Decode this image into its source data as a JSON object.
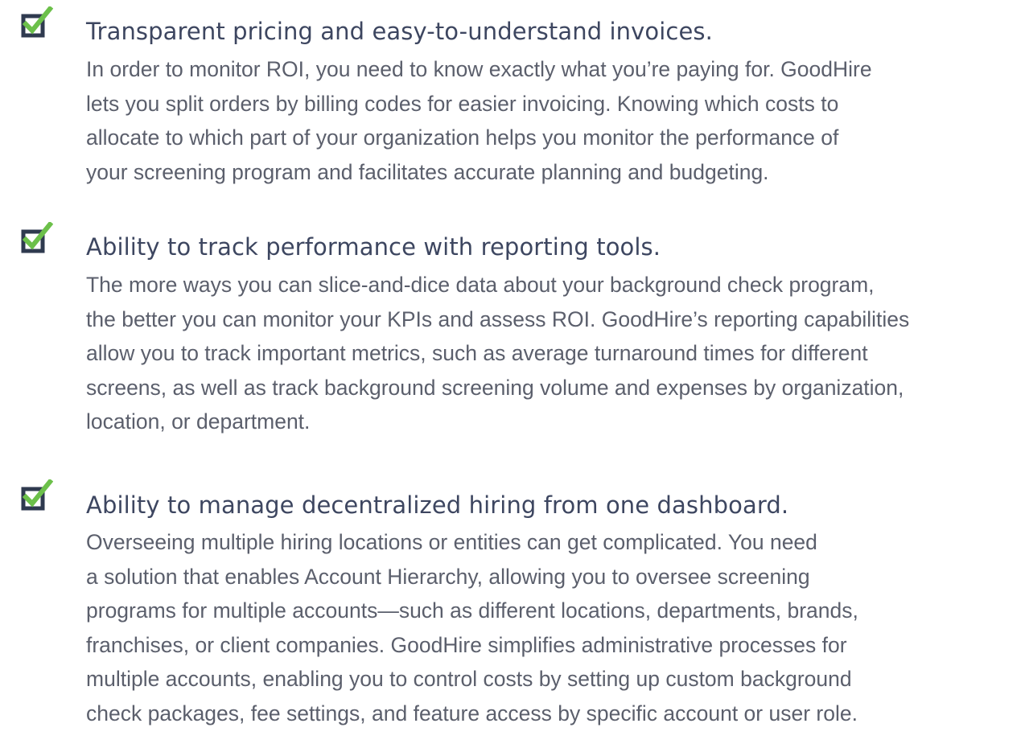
{
  "colors": {
    "checkbox_navy": "#2f3a4f",
    "check_green": "#6cc04a",
    "title_text": "#3d4660",
    "body_text": "#5b5f6c"
  },
  "icon": "checked-checkbox-icon",
  "items": [
    {
      "title": "Transparent pricing and easy-to-understand invoices.",
      "lines": [
        "In order to monitor ROI, you need to know exactly what you’re paying for. GoodHire",
        "lets you split orders by billing codes for easier invoicing. Knowing which costs to",
        "allocate to which part of your organization helps you monitor the performance of",
        "your screening program and facilitates accurate planning and budgeting."
      ]
    },
    {
      "title": "Ability to track performance with reporting tools.",
      "lines": [
        "The more ways you can slice-and-dice data about your background check program,",
        "the better you can monitor your KPIs and assess ROI. GoodHire’s reporting capabilities",
        "allow you to track important metrics, such as average turnaround times for different",
        "screens, as well as track background screening volume and expenses by organization,",
        "location, or department."
      ]
    },
    {
      "title": "Ability to manage decentralized hiring from one dashboard.",
      "lines": [
        "Overseeing multiple hiring locations or entities can get complicated. You need",
        "a solution that enables Account Hierarchy, allowing you to oversee screening",
        "programs for multiple accounts—such as different locations, departments, brands,",
        "franchises, or client companies. GoodHire simplifies administrative processes for",
        "multiple accounts, enabling you to control costs by setting up custom background",
        "check packages, fee settings, and feature access by specific account or user role."
      ]
    }
  ]
}
